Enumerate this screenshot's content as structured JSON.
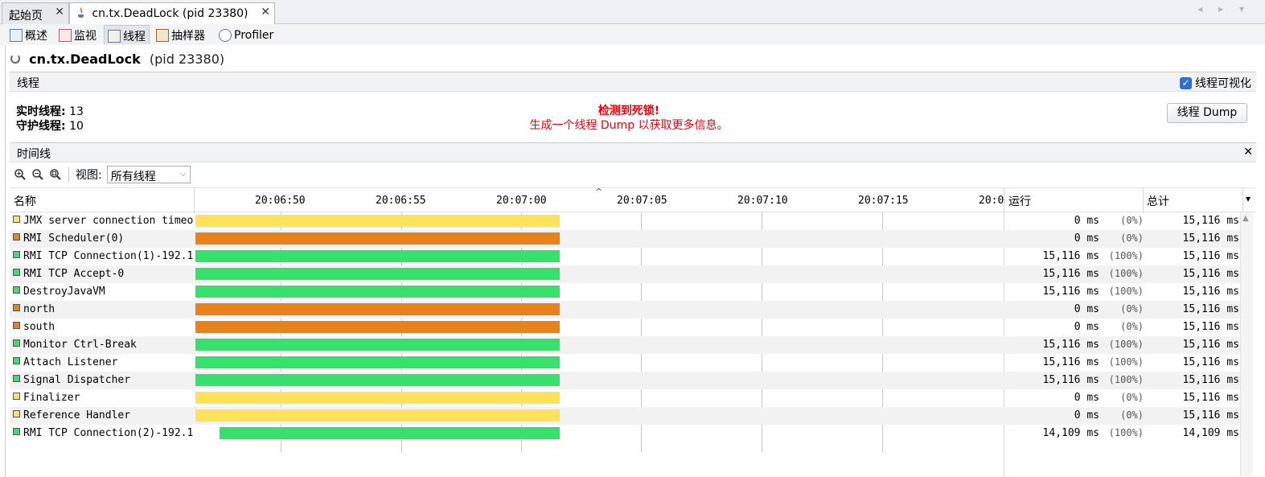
{
  "doc_tabs": [
    {
      "label": "起始页",
      "close": "✕"
    },
    {
      "label": "cn.tx.DeadLock (pid 23380)",
      "close": "✕"
    }
  ],
  "nav_arrows": "◂ ▸ ▾",
  "view_tabs": [
    {
      "label": "概述",
      "icon": "overview-icon"
    },
    {
      "label": "监视",
      "icon": "monitor-icon"
    },
    {
      "label": "线程",
      "icon": "threads-icon"
    },
    {
      "label": "抽样器",
      "icon": "sampler-icon"
    },
    {
      "label": "Profiler",
      "icon": "profiler-icon"
    }
  ],
  "app": {
    "name": "cn.tx.DeadLock",
    "pid": "(pid 23380)"
  },
  "threads_section": {
    "title": "线程",
    "visualize_label": "线程可视化",
    "visualize_checked": true,
    "live_label": "实时线程:",
    "live_value": "13",
    "daemon_label": "守护线程:",
    "daemon_value": "10",
    "deadlock_title": "检测到死锁!",
    "deadlock_msg": "生成一个线程 Dump 以获取更多信息。",
    "dump_button": "线程 Dump"
  },
  "timeline": {
    "title": "时间线",
    "close": "✕",
    "view_label": "视图:",
    "view_selected": "所有线程",
    "col_name": "名称",
    "col_running": "运行",
    "col_total": "总计",
    "sort_glyph": "^",
    "menu_glyph": "▾",
    "time_ticks": [
      "20:06:50",
      "20:06:55",
      "20:07:00",
      "20:07:05",
      "20:07:10",
      "20:07:15",
      "20:0"
    ]
  },
  "colors": {
    "green": "#37e06a",
    "orange": "#e8821c",
    "yellow": "#ffe15a",
    "deadlock_red": "#e8000c"
  },
  "threads": [
    {
      "name": "JMX server connection timeo",
      "state": "yellow",
      "running": "0 ms",
      "pct": "(0%)",
      "total": "15,116 ms",
      "start": 0
    },
    {
      "name": "RMI Scheduler(0)",
      "state": "orange",
      "running": "0 ms",
      "pct": "(0%)",
      "total": "15,116 ms",
      "start": 0
    },
    {
      "name": "RMI TCP Connection(1)-192.1",
      "state": "green",
      "running": "15,116 ms",
      "pct": "(100%)",
      "total": "15,116 ms",
      "start": 0
    },
    {
      "name": "RMI TCP Accept-0",
      "state": "green",
      "running": "15,116 ms",
      "pct": "(100%)",
      "total": "15,116 ms",
      "start": 0
    },
    {
      "name": "DestroyJavaVM",
      "state": "green",
      "running": "15,116 ms",
      "pct": "(100%)",
      "total": "15,116 ms",
      "start": 0
    },
    {
      "name": "north",
      "state": "orange",
      "running": "0 ms",
      "pct": "(0%)",
      "total": "15,116 ms",
      "start": 0
    },
    {
      "name": "south",
      "state": "orange",
      "running": "0 ms",
      "pct": "(0%)",
      "total": "15,116 ms",
      "start": 0
    },
    {
      "name": "Monitor Ctrl-Break",
      "state": "green",
      "running": "15,116 ms",
      "pct": "(100%)",
      "total": "15,116 ms",
      "start": 0
    },
    {
      "name": "Attach Listener",
      "state": "green",
      "running": "15,116 ms",
      "pct": "(100%)",
      "total": "15,116 ms",
      "start": 0
    },
    {
      "name": "Signal Dispatcher",
      "state": "green",
      "running": "15,116 ms",
      "pct": "(100%)",
      "total": "15,116 ms",
      "start": 0
    },
    {
      "name": "Finalizer",
      "state": "yellow",
      "running": "0 ms",
      "pct": "(0%)",
      "total": "15,116 ms",
      "start": 0
    },
    {
      "name": "Reference Handler",
      "state": "yellow",
      "running": "0 ms",
      "pct": "(0%)",
      "total": "15,116 ms",
      "start": 0
    },
    {
      "name": "RMI TCP Connection(2)-192.1",
      "state": "green",
      "running": "14,109 ms",
      "pct": "(100%)",
      "total": "14,109 ms",
      "start": 1
    }
  ]
}
